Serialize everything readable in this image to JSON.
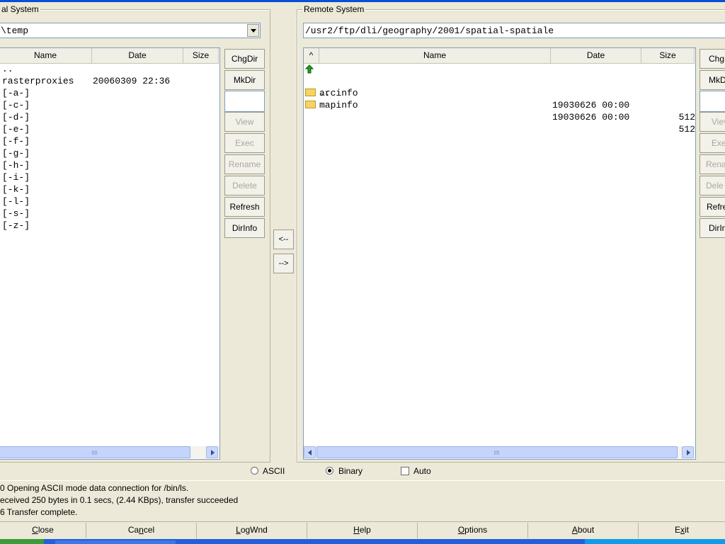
{
  "local": {
    "group_label": "al System",
    "path": "\\temp",
    "headers": {
      "name": "Name",
      "date": "Date",
      "size": "Size"
    },
    "rows": [
      {
        "name": "..",
        "date": ""
      },
      {
        "name": "rasterproxies",
        "date": "20060309 22:36"
      },
      {
        "name": "[-a-]",
        "date": ""
      },
      {
        "name": "[-c-]",
        "date": ""
      },
      {
        "name": "[-d-]",
        "date": ""
      },
      {
        "name": "[-e-]",
        "date": ""
      },
      {
        "name": "[-f-]",
        "date": ""
      },
      {
        "name": "[-g-]",
        "date": ""
      },
      {
        "name": "[-h-]",
        "date": ""
      },
      {
        "name": "[-i-]",
        "date": ""
      },
      {
        "name": "[-k-]",
        "date": ""
      },
      {
        "name": "[-l-]",
        "date": ""
      },
      {
        "name": "[-s-]",
        "date": ""
      },
      {
        "name": "[-z-]",
        "date": ""
      }
    ],
    "buttons": {
      "chgdir": "ChgDir",
      "mkdir": "MkDir",
      "view": "View",
      "exec": "Exec",
      "rename": "Rename",
      "delete": "Delete",
      "refresh": "Refresh",
      "dirinfo": "DirInfo"
    }
  },
  "remote": {
    "group_label": "Remote System",
    "path": "/usr2/ftp/dli/geography/2001/spatial-spatiale",
    "headers": {
      "sort": "^",
      "name": "Name",
      "date": "Date",
      "size": "Size"
    },
    "rows": [
      {
        "name": "..",
        "date": "",
        "size": "",
        "icon": "up-arrow-icon"
      },
      {
        "name": "arcinfo",
        "date": "19030626 00:00",
        "size": "512",
        "icon": "folder-icon"
      },
      {
        "name": "mapinfo",
        "date": "19030626 00:00",
        "size": "512",
        "icon": "folder-icon"
      }
    ],
    "buttons": {
      "chgdir": "ChgD",
      "mkdir": "MkD",
      "view": "Viev",
      "exec": "Exe",
      "rename": "Rena",
      "delete": "Dele",
      "refresh": "Refre",
      "dirinfo": "DirIn"
    }
  },
  "transfer": {
    "to_local": "<--",
    "to_remote": "-->"
  },
  "mode": {
    "ascii": "ASCII",
    "binary": "Binary",
    "auto": "Auto",
    "selected": "Binary"
  },
  "log": [
    "0 Opening ASCII mode data connection for /bin/ls.",
    "eceived 250 bytes in 0.1 secs, (2.44 KBps), transfer succeeded",
    "6 Transfer complete."
  ],
  "bottom_buttons": {
    "close": {
      "pre": "",
      "u": "C",
      "post": "lose"
    },
    "cancel": {
      "pre": "Ca",
      "u": "n",
      "post": "cel"
    },
    "logwnd": {
      "pre": "",
      "u": "L",
      "post": "ogWnd"
    },
    "help": {
      "pre": "",
      "u": "H",
      "post": "elp"
    },
    "options": {
      "pre": "",
      "u": "O",
      "post": "ptions"
    },
    "about": {
      "pre": "",
      "u": "A",
      "post": "bout"
    },
    "exit": {
      "pre": "E",
      "u": "x",
      "post": "it"
    }
  },
  "colors": {
    "titlebar": "#0a4fd6",
    "window_bg": "#ece9d8",
    "taskbar": "#245edb"
  }
}
